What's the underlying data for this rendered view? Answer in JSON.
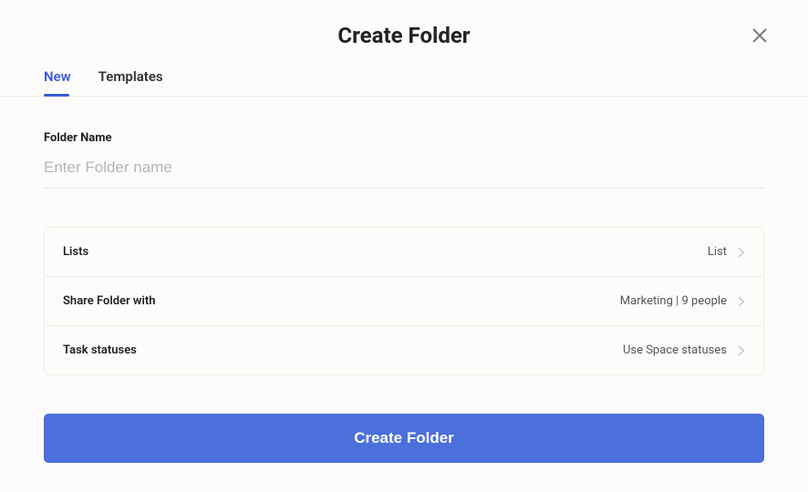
{
  "header": {
    "title": "Create Folder"
  },
  "tabs": {
    "new": "New",
    "templates": "Templates"
  },
  "form": {
    "folder_name_label": "Folder Name",
    "folder_name_placeholder": "Enter Folder name",
    "folder_name_value": ""
  },
  "settings": {
    "lists": {
      "label": "Lists",
      "value": "List"
    },
    "share": {
      "label": "Share Folder with",
      "value": "Marketing | 9 people"
    },
    "statuses": {
      "label": "Task statuses",
      "value": "Use Space statuses"
    }
  },
  "actions": {
    "submit": "Create Folder"
  }
}
